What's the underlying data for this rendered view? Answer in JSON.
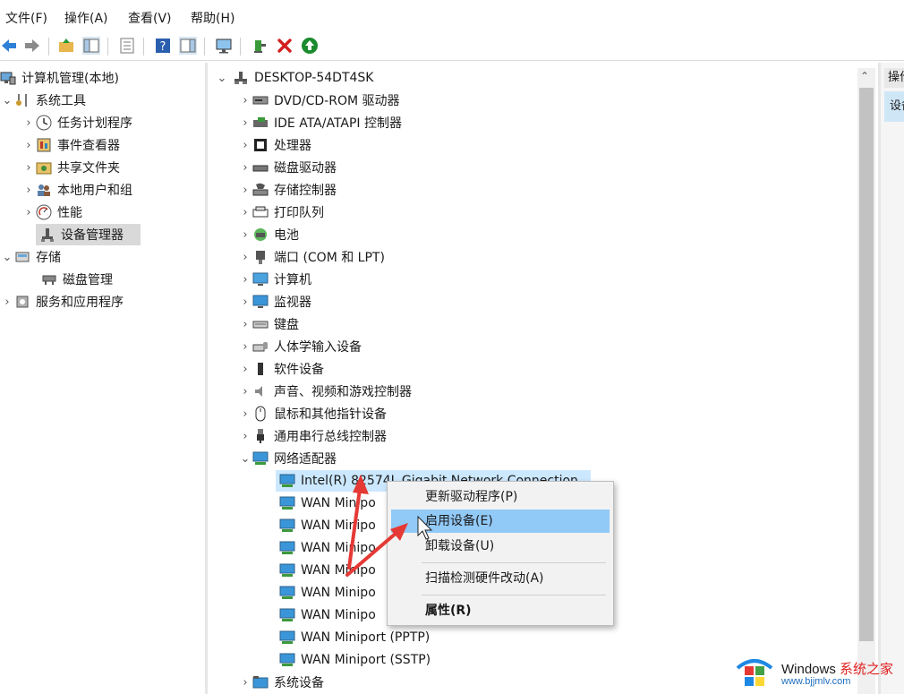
{
  "menu": [
    {
      "label": "文件(F)"
    },
    {
      "label": "操作(A)"
    },
    {
      "label": "查看(V)"
    },
    {
      "label": "帮助(H)"
    }
  ],
  "left_tree": {
    "root": "计算机管理(本地)",
    "system_tools": "系统工具",
    "task_scheduler": "任务计划程序",
    "event_viewer": "事件查看器",
    "shared_folders": "共享文件夹",
    "local_users": "本地用户和组",
    "performance": "性能",
    "device_manager": "设备管理器",
    "storage": "存储",
    "disk_management": "磁盘管理",
    "services_apps": "服务和应用程序"
  },
  "device_tree": {
    "root": "DESKTOP-54DT4SK",
    "categories": [
      {
        "label": "DVD/CD-ROM 驱动器"
      },
      {
        "label": "IDE ATA/ATAPI 控制器"
      },
      {
        "label": "处理器"
      },
      {
        "label": "磁盘驱动器"
      },
      {
        "label": "存储控制器"
      },
      {
        "label": "打印队列"
      },
      {
        "label": "电池"
      },
      {
        "label": "端口 (COM 和 LPT)"
      },
      {
        "label": "计算机"
      },
      {
        "label": "监视器"
      },
      {
        "label": "键盘"
      },
      {
        "label": "人体学输入设备"
      },
      {
        "label": "软件设备"
      },
      {
        "label": "声音、视频和游戏控制器"
      },
      {
        "label": "鼠标和其他指针设备"
      },
      {
        "label": "通用串行总线控制器"
      },
      {
        "label": "网络适配器"
      }
    ],
    "network_adapters": [
      {
        "label": "Intel(R) 82574L Gigabit Network Connection"
      },
      {
        "label": "WAN Minipo"
      },
      {
        "label": "WAN Minipo"
      },
      {
        "label": "WAN Minipo"
      },
      {
        "label": "WAN Minipo"
      },
      {
        "label": "WAN Minipo"
      },
      {
        "label": "WAN Minipo"
      },
      {
        "label": "WAN Miniport (PPTP)"
      },
      {
        "label": "WAN Miniport (SSTP)"
      }
    ],
    "last_category": "系统设备"
  },
  "context_menu": {
    "update_driver": "更新驱动程序(P)",
    "enable_device": "启用设备(E)",
    "uninstall_device": "卸载设备(U)",
    "scan_hardware": "扫描检测硬件改动(A)",
    "properties": "属性(R)"
  },
  "actions_pane": {
    "header": "操作",
    "item": "设备管理器"
  },
  "watermark": {
    "title": "Windows",
    "title_suffix": "系统之家",
    "url": "www.bjjmlv.com"
  },
  "colors": {
    "selection": "#d9d9d9",
    "hover": "#cce8ff",
    "menu_highlight": "#91c9f7",
    "annotation_arrow": "#e53935"
  }
}
